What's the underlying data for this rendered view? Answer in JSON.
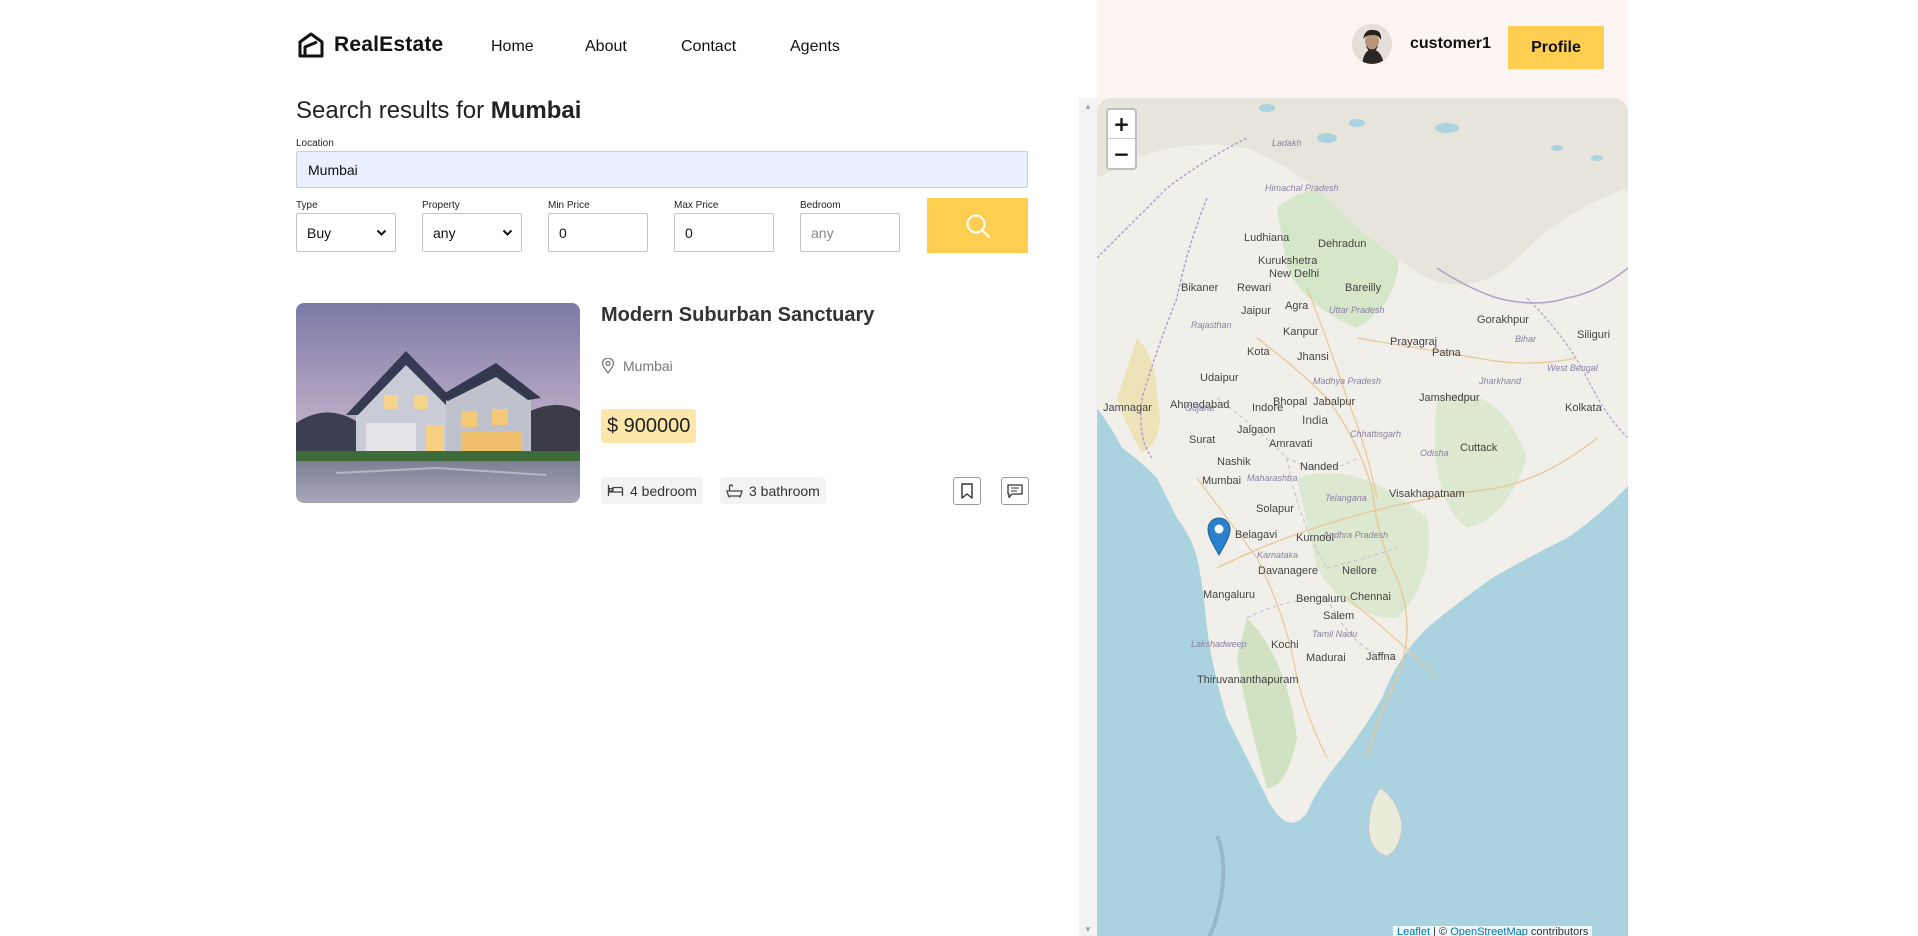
{
  "brand": {
    "name": "RealEstate"
  },
  "nav": [
    {
      "label": "Home"
    },
    {
      "label": "About"
    },
    {
      "label": "Contact"
    },
    {
      "label": "Agents"
    }
  ],
  "user": {
    "name": "customer1",
    "profile_label": "Profile"
  },
  "search": {
    "title_prefix": "Search results for",
    "title_city": "Mumbai",
    "location_label": "Location",
    "location_value": "Mumbai",
    "type_label": "Type",
    "type_value": "Buy",
    "property_label": "Property",
    "property_value": "any",
    "min_price_label": "Min Price",
    "min_price_value": "0",
    "max_price_label": "Max Price",
    "max_price_value": "0",
    "bedroom_label": "Bedroom",
    "bedroom_placeholder": "any"
  },
  "listing": {
    "title": "Modern Suburban Sanctuary",
    "address": "Mumbai",
    "price": "$ 900000",
    "bedrooms": "4 bedroom",
    "bathrooms": "3 bathroom"
  },
  "map": {
    "attribution_leaflet": "Leaflet",
    "attribution_sep": "| ©",
    "attribution_osm": "OpenStreetMap",
    "attribution_tail": "contributors",
    "zoom_in": "+",
    "zoom_out": "−",
    "labels": [
      "Ladakh",
      "Himachal Pradesh",
      "Ludhiana",
      "Dehradun",
      "Kurukshetra",
      "New Delhi",
      "Bikaner",
      "Rewari",
      "Bareilly",
      "Jaipur",
      "Agra",
      "Uttar Pradesh",
      "Gorakhpur",
      "Siliguri",
      "Rajasthan",
      "Kanpur",
      "Prayagraj",
      "Patna",
      "Bihar",
      "Kota",
      "Jhansi",
      "West Bengal",
      "Udaipur",
      "Madhya Pradesh",
      "Jharkhand",
      "Ahmedabad",
      "Bhopal",
      "Jamshedpur",
      "Kolkata",
      "Jamnagar",
      "Gujarat",
      "Indore",
      "Jabalpur",
      "India",
      "Surat",
      "Jalgaon",
      "Chhattisgarh",
      "Amravati",
      "Cuttack",
      "Odisha",
      "Nashik",
      "Nanded",
      "Mumbai",
      "Maharashtra",
      "Visakhapatnam",
      "Solapur",
      "Telangana",
      "Belagavi",
      "Kurnool",
      "Andhra Pradesh",
      "Karnataka",
      "Davanagere",
      "Nellore",
      "Mangaluru",
      "Bengaluru",
      "Chennai",
      "Salem",
      "Tamil Nadu",
      "Lakshadweep",
      "Kochi",
      "Madurai",
      "Jaffna",
      "Thiruvananthapuram"
    ]
  }
}
